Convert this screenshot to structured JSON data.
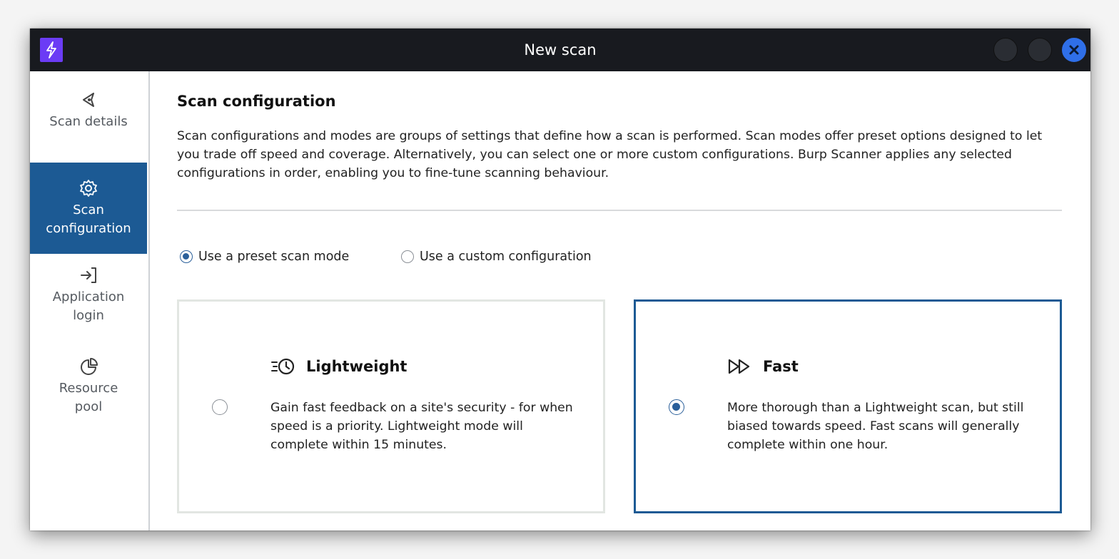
{
  "window": {
    "title": "New scan"
  },
  "sidebar": {
    "items": [
      {
        "label": "Scan details",
        "icon": "target-arrow-icon",
        "active": false
      },
      {
        "label": "Scan\nconfiguration",
        "icon": "gear-icon",
        "active": true
      },
      {
        "label": "Application\nlogin",
        "icon": "login-icon",
        "active": false
      },
      {
        "label": "Resource\npool",
        "icon": "pie-chart-icon",
        "active": false
      }
    ]
  },
  "main": {
    "heading": "Scan configuration",
    "description": "Scan configurations and modes are groups of settings that define how a scan is performed. Scan modes offer preset options designed to let you trade off speed and coverage. Alternatively, you can select one or more custom configurations. Burp Scanner applies any selected configurations in order, enabling you to fine-tune scanning behaviour.",
    "mode_options": [
      {
        "label": "Use a preset scan mode",
        "selected": true
      },
      {
        "label": "Use a custom configuration",
        "selected": false
      }
    ],
    "presets": [
      {
        "title": "Lightweight",
        "icon": "fast-clock-icon",
        "description": "Gain fast feedback on a site's security - for when speed is a priority. Lightweight mode will complete within 15 minutes.",
        "selected": false
      },
      {
        "title": "Fast",
        "icon": "fast-forward-icon",
        "description": "More thorough than a Lightweight scan, but still biased towards speed. Fast scans will generally complete within one hour.",
        "selected": true
      }
    ]
  },
  "colors": {
    "titlebar": "#181a1f",
    "accent": "#1c5a94",
    "app_icon": "#6b3cf5",
    "close_button": "#2f6fe8"
  }
}
